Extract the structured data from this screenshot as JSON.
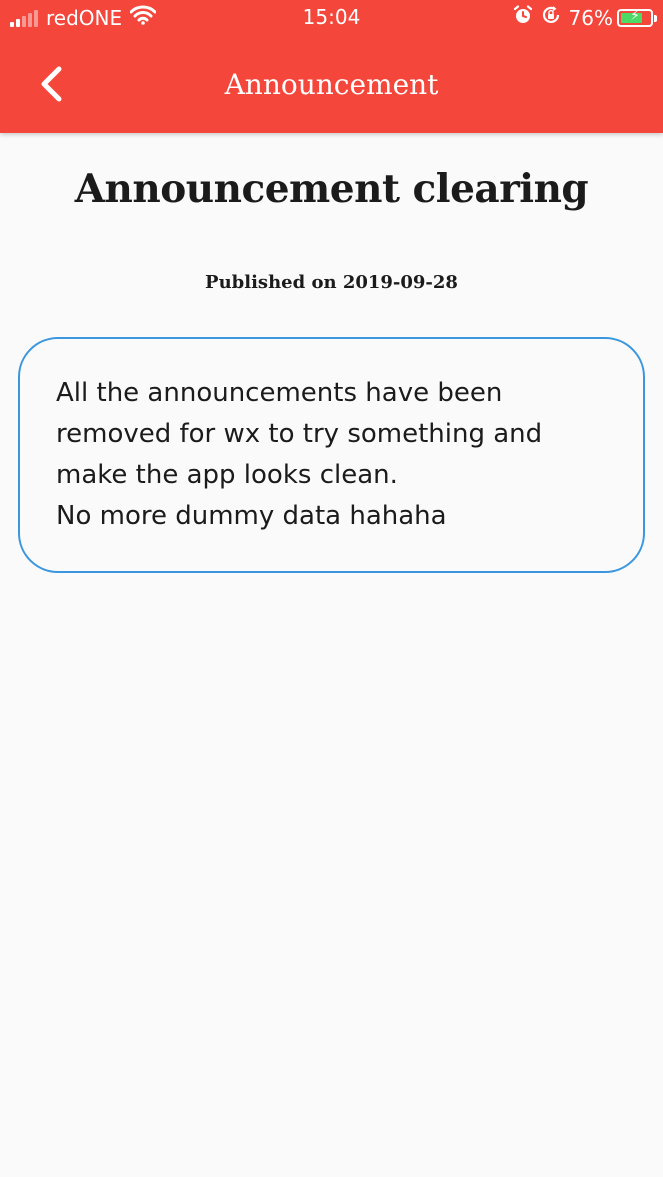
{
  "status_bar": {
    "carrier": "redONE",
    "time": "15:04",
    "battery_percent": "76%",
    "battery_level": 0.76,
    "icons": [
      "signal-icon",
      "wifi-icon",
      "alarm-icon",
      "rotation-lock-icon",
      "battery-charging-icon"
    ]
  },
  "app_bar": {
    "title": "Announcement",
    "back_icon": "chevron-left-icon",
    "color": "#f4463b"
  },
  "announcement": {
    "title": "Announcement clearing",
    "published": "Published on 2019-09-28",
    "body": "All the announcements have been removed for wx to try something and make the app looks clean.\nNo more dummy data hahaha",
    "border_color": "#3a97df"
  }
}
